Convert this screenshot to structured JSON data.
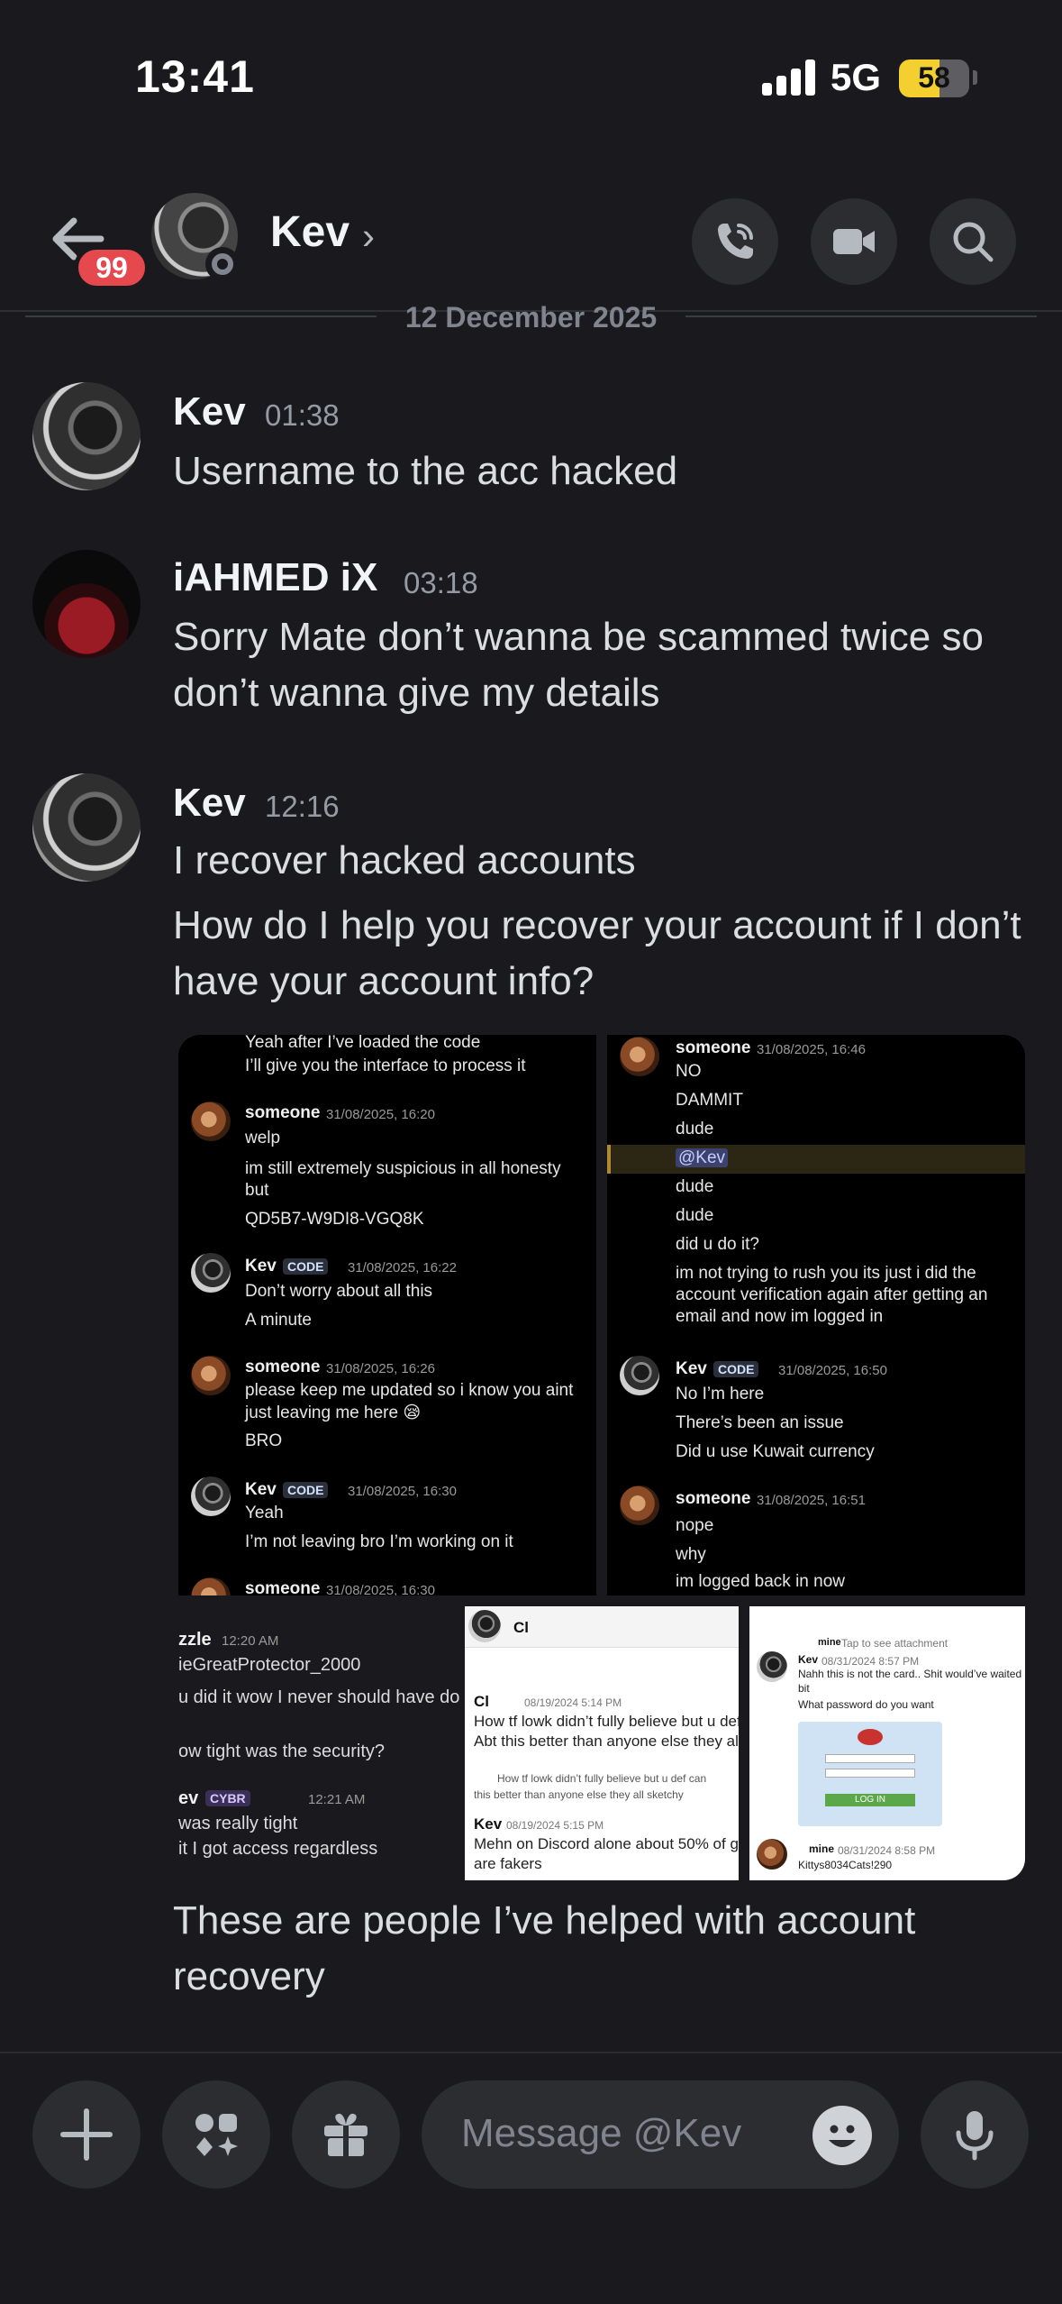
{
  "status_bar": {
    "time": "13:41",
    "network": "5G",
    "battery": "58",
    "battery_level_percent": 58
  },
  "header": {
    "back_icon": "arrow-left-icon",
    "unread_count": "99",
    "title": "Kev",
    "chevron": "›",
    "actions": [
      "phone-icon",
      "video-camera-icon",
      "search-icon"
    ]
  },
  "date_separator": "12 December 2025",
  "messages": [
    {
      "author": "Kev",
      "time": "01:38",
      "lines": [
        "Username to the acc hacked"
      ]
    },
    {
      "author": "iAHMED iX",
      "time": "03:18",
      "lines": [
        "Sorry Mate don’t wanna be scammed twice so don’t wanna give my details"
      ]
    },
    {
      "author": "Kev",
      "time": "12:16",
      "lines": [
        "I recover hacked accounts",
        "How do I help you recover your account if I don’t have your account info?"
      ]
    }
  ],
  "attachment_left": {
    "rows": [
      {
        "text": "Yeah after I’ve loaded the code"
      },
      {
        "text": "I’ll give you the interface to process it"
      },
      {
        "name": "someone",
        "ts": "31/08/2025, 16:20"
      },
      {
        "text": "welp"
      },
      {
        "text": "im still extremely suspicious in all honesty"
      },
      {
        "text": "but"
      },
      {
        "text": "QD5B7-W9DI8-VGQ8K"
      },
      {
        "name": "Kev",
        "tag": "CODE",
        "ts": "31/08/2025, 16:22"
      },
      {
        "text": "Don’t worry about all this"
      },
      {
        "text": "A minute"
      },
      {
        "name": "someone",
        "ts": "31/08/2025, 16:26"
      },
      {
        "text": "please keep me updated so i know you aint"
      },
      {
        "text": "just leaving me here 😪"
      },
      {
        "text": "BRO"
      },
      {
        "name": "Kev",
        "tag": "CODE",
        "ts": "31/08/2025, 16:30"
      },
      {
        "text": "Yeah"
      },
      {
        "text": "I’m not leaving bro I’m working on it"
      },
      {
        "name": "someone",
        "ts": "31/08/2025, 16:30"
      }
    ]
  },
  "attachment_right": {
    "rows": [
      {
        "name": "someone",
        "ts": "31/08/2025, 16:46"
      },
      {
        "text": "NO"
      },
      {
        "text": "DAMMIT"
      },
      {
        "text": "dude"
      },
      {
        "mention": "@Kev"
      },
      {
        "text": "dude"
      },
      {
        "text": "dude"
      },
      {
        "text": "did u do it?"
      },
      {
        "text": "im not trying to rush you its just i did the"
      },
      {
        "text": "account verification again after getting an"
      },
      {
        "text": "email and now im logged in"
      },
      {
        "name": "Kev",
        "tag": "CODE",
        "ts": "31/08/2025, 16:50"
      },
      {
        "text": "No I’m here"
      },
      {
        "text": "There’s been an issue"
      },
      {
        "text": "Did u use Kuwait currency"
      },
      {
        "name": "someone",
        "ts": "31/08/2025, 16:51"
      },
      {
        "text": "nope"
      },
      {
        "text": "why"
      },
      {
        "text": "im logged back in now"
      }
    ]
  },
  "attachment_bottom_left": {
    "rows": [
      {
        "name": "zzle",
        "ts": "12:20 AM"
      },
      {
        "text": "ieGreatProtector_2000"
      },
      {
        "text": "u did it wow I never should have do"
      },
      {
        "text": "ow tight was the security?"
      },
      {
        "name": "ev",
        "tag": "CYBR",
        "ts": "12:21 AM"
      },
      {
        "text": "was really tight"
      },
      {
        "text": "it I got access regardless"
      }
    ]
  },
  "attachment_bottom_mid": {
    "header": "Cl",
    "rows": [
      {
        "name": "Cl",
        "ts": "08/19/2024 5:14 PM"
      },
      {
        "text": "How tf lowk didn’t fully believe but u def ca"
      },
      {
        "text": "Abt this better than anyone else they all s"
      },
      {
        "text": "How tf lowk didn’t fully believe but u def can"
      },
      {
        "text": "this better than anyone else they all sketchy"
      },
      {
        "name": "Kev",
        "ts": "08/19/2024 5:15 PM"
      },
      {
        "text": "Mehn on Discord alone about 50% of guys"
      },
      {
        "text": "are fakers"
      }
    ]
  },
  "attachment_bottom_right": {
    "rows": [
      {
        "name": "mine",
        "ts": "Tap to see attachment"
      },
      {
        "name": "Kev",
        "ts": "08/31/2024 8:57 PM"
      },
      {
        "text": "Nahh this is not the card.. Shit would’ve waited a"
      },
      {
        "text": "bit"
      },
      {
        "text": "What password do you want"
      },
      {
        "text": "LOG IN"
      },
      {
        "name": "mine",
        "ts": "08/31/2024 8:58 PM"
      },
      {
        "text": "Kittys8034Cats!290"
      }
    ]
  },
  "followup_text": "These are people I’ve helped with account recovery",
  "composer": {
    "placeholder": "Message @Kev",
    "buttons": [
      "plus-icon",
      "apps-icon",
      "gift-icon"
    ],
    "emoji_icon": "emoji-icon",
    "mic_icon": "microphone-icon"
  }
}
